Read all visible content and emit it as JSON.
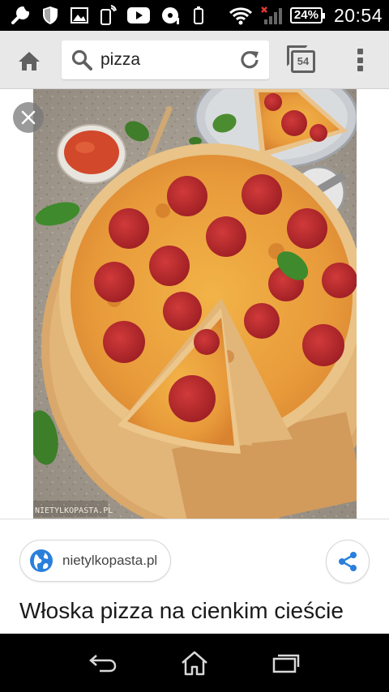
{
  "status_bar": {
    "battery": "24%",
    "time": "20:54",
    "icons": [
      "wrench-icon",
      "shield-icon",
      "image-icon",
      "phone-signal-icon",
      "youtube-icon",
      "cd-icon",
      "phone-icon",
      "wifi-icon",
      "cellular-signal-icon",
      "battery-icon"
    ]
  },
  "toolbar": {
    "search_query": "pizza",
    "tab_count": "54",
    "icons": [
      "home-icon",
      "search-icon",
      "reload-icon",
      "tabs-icon",
      "overflow-menu-icon"
    ]
  },
  "image": {
    "watermark": "NIETYLKOPASTA.PL",
    "close_icon": "close-icon"
  },
  "result": {
    "source_domain": "nietylkopasta.pl",
    "title": "Włoska pizza na cienkim cieście",
    "icons": [
      "globe-icon",
      "share-icon"
    ]
  },
  "nav_bar": {
    "icons": [
      "back-icon",
      "home-icon",
      "recents-icon"
    ]
  },
  "colors": {
    "toolbar_bg": "#e8e8e8",
    "status_bg": "#000000",
    "accent_blue": "#2a7fdb",
    "pepperoni": "#b8232a",
    "crust": "#e2b46c"
  }
}
